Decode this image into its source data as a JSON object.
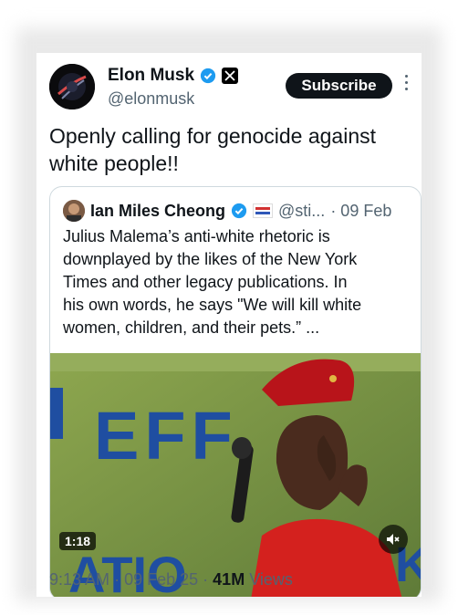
{
  "author": {
    "name": "Elon Musk",
    "handle": "@elonmusk"
  },
  "subscribe_label": "Subscribe",
  "tweet": {
    "line1": "Openly calling for genocide against",
    "line2": "white people!!"
  },
  "quote": {
    "name": "Ian Miles Cheong",
    "handle": "@sti...",
    "date": "· 09 Feb",
    "lines": [
      "Julius Malema’s anti-white rhetoric  is",
      "downplayed by the likes of the New York",
      "Times and other legacy publications. In",
      "his own words, he says \"We will kill white",
      "women, children, and their pets.” ..."
    ]
  },
  "video": {
    "duration": "1:18",
    "banner_text": "EFF",
    "bottom_text": "ATIO"
  },
  "meta": {
    "time": "9:13 AM",
    "date": "09 Feb 25",
    "views_count": "41M",
    "views_label": "Views",
    "sep": "·"
  },
  "colors": {
    "verified_blue": "#1d9bf0",
    "text": "#0f1419",
    "muted": "#536471",
    "beret_red": "#b8141a",
    "shirt_red": "#d4211e",
    "banner_blue": "#1f4ea1"
  },
  "icons": [
    "verified-badge-icon",
    "x-logo-icon",
    "more-icon",
    "mute-icon"
  ]
}
